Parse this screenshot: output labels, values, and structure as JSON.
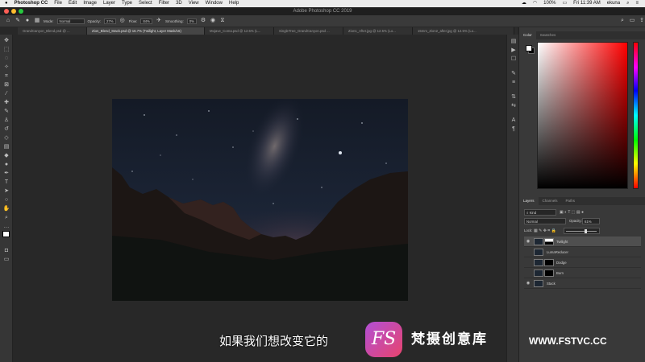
{
  "menubar": {
    "app": "Photoshop CC",
    "items": [
      "File",
      "Edit",
      "Image",
      "Layer",
      "Type",
      "Select",
      "Filter",
      "3D",
      "View",
      "Window",
      "Help"
    ],
    "battery": "100%",
    "clock": "Fri 11:39 AM",
    "user": "ekuna"
  },
  "window": {
    "title": "Adobe Photoshop CC 2019"
  },
  "options": {
    "mode_label": "Mode:",
    "mode_value": "Normal",
    "opacity_label": "Opacity:",
    "opacity_value": "27%",
    "flow_label": "Flow:",
    "flow_value": "84%",
    "smoothing_label": "Smoothing:",
    "smoothing_value": "0%"
  },
  "tabs": [
    {
      "label": "GrandCanyon_Blend.psd @ ..."
    },
    {
      "label": "Zion_Blend_Stack.psd @ 16.7% (Twilight, Layer Mask/16)",
      "active": true
    },
    {
      "label": "Mojave_Coma.psd @ 12.5% (L..."
    },
    {
      "label": "SingleTree_GrandCanyon.psd ..."
    },
    {
      "label": "Zion1_After.jpg @ 12.5% (Lo..."
    },
    {
      "label": "15mm_Zion2_after.jpg @ 12.5% (Lo..."
    }
  ],
  "color_panel": {
    "tab_color": "Color",
    "tab_swatches": "Swatches",
    "foreground": "#ffffff",
    "background": "#000000"
  },
  "layers_panel": {
    "tabs": [
      "Layers",
      "Channels",
      "Paths"
    ],
    "filter_kind": "Kind",
    "blend_mode": "Normal",
    "opacity_label": "Opacity:",
    "opacity_value": "61%",
    "lock_label": "Lock:",
    "fill_label": "Fill:",
    "layers": [
      {
        "name": "Twilight",
        "visible": true,
        "selected": true,
        "has_mask": true
      },
      {
        "name": "LumaReducer",
        "visible": false,
        "selected": false,
        "has_mask": false
      },
      {
        "name": "Dodge",
        "visible": false,
        "selected": false,
        "has_mask": true
      },
      {
        "name": "Burn",
        "visible": false,
        "selected": false,
        "has_mask": true
      },
      {
        "name": "Stack",
        "visible": true,
        "selected": false,
        "has_mask": false
      }
    ]
  },
  "subtitle": "如果我们想改变它的",
  "watermark": {
    "logo": "FS",
    "brand": "梵摄创意库",
    "url": "WWW.FSTVC.CC"
  }
}
